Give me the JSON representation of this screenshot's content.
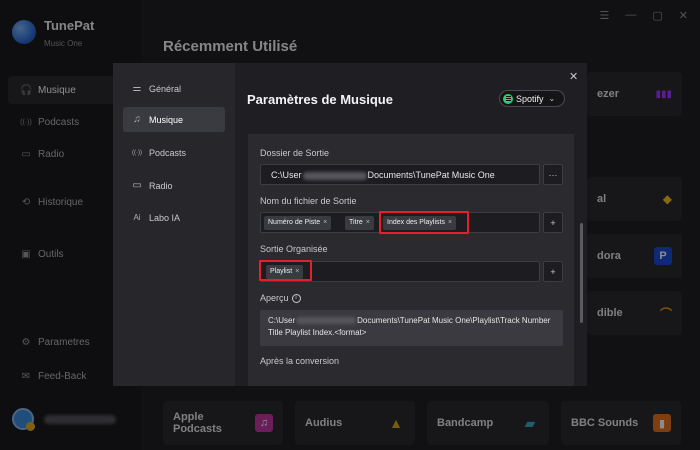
{
  "app": {
    "name": "TunePat",
    "sub": "Music One",
    "heading": "Récemment Utilisé",
    "window_controls": [
      "☰",
      "—",
      "▢",
      "✕"
    ]
  },
  "sidebar": {
    "items": [
      {
        "label": "Musique",
        "icon": "headphones-icon",
        "glyph": "🎧"
      },
      {
        "label": "Podcasts",
        "icon": "podcast-icon",
        "glyph": "((·))"
      },
      {
        "label": "Radio",
        "icon": "radio-icon",
        "glyph": "▭"
      },
      {
        "label": "Historique",
        "icon": "history-icon",
        "glyph": "⟲"
      },
      {
        "label": "Outils",
        "icon": "toolbox-icon",
        "glyph": "▣"
      }
    ],
    "bottom_items": [
      {
        "label": "Parametres",
        "icon": "gear-icon",
        "glyph": "⚙"
      },
      {
        "label": "Feed-Back",
        "icon": "mail-icon",
        "glyph": "✉"
      }
    ]
  },
  "tiles": [
    {
      "label": "Apple Podcasts",
      "logo_color": "#c23aa7",
      "glyph": "♫"
    },
    {
      "label": "Audius",
      "logo_color": "#d9a61a",
      "glyph": "▲"
    },
    {
      "label": "Bandcamp",
      "logo_color": "#3aa8c8",
      "glyph": "▰"
    },
    {
      "label": "BBC Sounds",
      "logo_color": "#e8721c",
      "glyph": "▮"
    }
  ],
  "peeks": [
    "ezer",
    "al",
    "dora",
    "dible"
  ],
  "dialog": {
    "title": "Paramètres de Musique",
    "nav": [
      {
        "label": "Général",
        "icon": "sliders-icon",
        "glyph": "⚌"
      },
      {
        "label": "Musique",
        "icon": "music-note-icon",
        "glyph": "♫"
      },
      {
        "label": "Podcasts",
        "icon": "podcast-icon",
        "glyph": "((·))"
      },
      {
        "label": "Radio",
        "icon": "radio-icon",
        "glyph": "▭"
      },
      {
        "label": "Labo IA",
        "icon": "ai-icon",
        "glyph": "Ai"
      }
    ],
    "service": "Spotify",
    "output_folder": {
      "label": "Dossier de Sortie",
      "prefix": "C:\\User",
      "suffix": "Documents\\TunePat Music One",
      "browse": "···"
    },
    "filename": {
      "label": "Nom du fichier de Sortie",
      "chips": [
        "Numéro de Piste",
        "Titre",
        "Index des Playlists"
      ],
      "add": "+"
    },
    "organized": {
      "label": "Sortie Organisée",
      "chips": [
        "Playlist"
      ],
      "add": "+"
    },
    "preview": {
      "label": "Aperçu",
      "info": "i",
      "line1_prefix": "C:\\User",
      "line1_suffix": "Documents\\TunePat Music One\\Playlist\\Track Number",
      "line2": "Title Playlist Index.<format>"
    },
    "after": {
      "label": "Après la conversion"
    },
    "close": "✕",
    "chip_close": "×"
  },
  "colors": {
    "accent": "#1ed760",
    "highlight": "#e4212a"
  }
}
